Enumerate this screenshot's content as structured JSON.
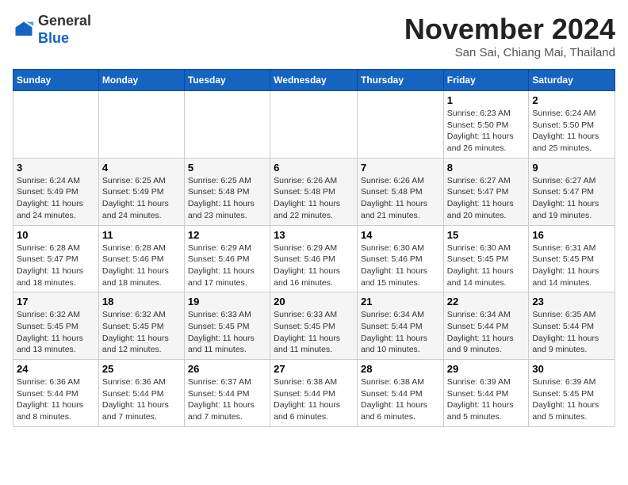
{
  "logo": {
    "general": "General",
    "blue": "Blue"
  },
  "title": "November 2024",
  "location": "San Sai, Chiang Mai, Thailand",
  "days_of_week": [
    "Sunday",
    "Monday",
    "Tuesday",
    "Wednesday",
    "Thursday",
    "Friday",
    "Saturday"
  ],
  "weeks": [
    [
      {
        "day": "",
        "info": ""
      },
      {
        "day": "",
        "info": ""
      },
      {
        "day": "",
        "info": ""
      },
      {
        "day": "",
        "info": ""
      },
      {
        "day": "",
        "info": ""
      },
      {
        "day": "1",
        "info": "Sunrise: 6:23 AM\nSunset: 5:50 PM\nDaylight: 11 hours and 26 minutes."
      },
      {
        "day": "2",
        "info": "Sunrise: 6:24 AM\nSunset: 5:50 PM\nDaylight: 11 hours and 25 minutes."
      }
    ],
    [
      {
        "day": "3",
        "info": "Sunrise: 6:24 AM\nSunset: 5:49 PM\nDaylight: 11 hours and 24 minutes."
      },
      {
        "day": "4",
        "info": "Sunrise: 6:25 AM\nSunset: 5:49 PM\nDaylight: 11 hours and 24 minutes."
      },
      {
        "day": "5",
        "info": "Sunrise: 6:25 AM\nSunset: 5:48 PM\nDaylight: 11 hours and 23 minutes."
      },
      {
        "day": "6",
        "info": "Sunrise: 6:26 AM\nSunset: 5:48 PM\nDaylight: 11 hours and 22 minutes."
      },
      {
        "day": "7",
        "info": "Sunrise: 6:26 AM\nSunset: 5:48 PM\nDaylight: 11 hours and 21 minutes."
      },
      {
        "day": "8",
        "info": "Sunrise: 6:27 AM\nSunset: 5:47 PM\nDaylight: 11 hours and 20 minutes."
      },
      {
        "day": "9",
        "info": "Sunrise: 6:27 AM\nSunset: 5:47 PM\nDaylight: 11 hours and 19 minutes."
      }
    ],
    [
      {
        "day": "10",
        "info": "Sunrise: 6:28 AM\nSunset: 5:47 PM\nDaylight: 11 hours and 18 minutes."
      },
      {
        "day": "11",
        "info": "Sunrise: 6:28 AM\nSunset: 5:46 PM\nDaylight: 11 hours and 18 minutes."
      },
      {
        "day": "12",
        "info": "Sunrise: 6:29 AM\nSunset: 5:46 PM\nDaylight: 11 hours and 17 minutes."
      },
      {
        "day": "13",
        "info": "Sunrise: 6:29 AM\nSunset: 5:46 PM\nDaylight: 11 hours and 16 minutes."
      },
      {
        "day": "14",
        "info": "Sunrise: 6:30 AM\nSunset: 5:46 PM\nDaylight: 11 hours and 15 minutes."
      },
      {
        "day": "15",
        "info": "Sunrise: 6:30 AM\nSunset: 5:45 PM\nDaylight: 11 hours and 14 minutes."
      },
      {
        "day": "16",
        "info": "Sunrise: 6:31 AM\nSunset: 5:45 PM\nDaylight: 11 hours and 14 minutes."
      }
    ],
    [
      {
        "day": "17",
        "info": "Sunrise: 6:32 AM\nSunset: 5:45 PM\nDaylight: 11 hours and 13 minutes."
      },
      {
        "day": "18",
        "info": "Sunrise: 6:32 AM\nSunset: 5:45 PM\nDaylight: 11 hours and 12 minutes."
      },
      {
        "day": "19",
        "info": "Sunrise: 6:33 AM\nSunset: 5:45 PM\nDaylight: 11 hours and 11 minutes."
      },
      {
        "day": "20",
        "info": "Sunrise: 6:33 AM\nSunset: 5:45 PM\nDaylight: 11 hours and 11 minutes."
      },
      {
        "day": "21",
        "info": "Sunrise: 6:34 AM\nSunset: 5:44 PM\nDaylight: 11 hours and 10 minutes."
      },
      {
        "day": "22",
        "info": "Sunrise: 6:34 AM\nSunset: 5:44 PM\nDaylight: 11 hours and 9 minutes."
      },
      {
        "day": "23",
        "info": "Sunrise: 6:35 AM\nSunset: 5:44 PM\nDaylight: 11 hours and 9 minutes."
      }
    ],
    [
      {
        "day": "24",
        "info": "Sunrise: 6:36 AM\nSunset: 5:44 PM\nDaylight: 11 hours and 8 minutes."
      },
      {
        "day": "25",
        "info": "Sunrise: 6:36 AM\nSunset: 5:44 PM\nDaylight: 11 hours and 7 minutes."
      },
      {
        "day": "26",
        "info": "Sunrise: 6:37 AM\nSunset: 5:44 PM\nDaylight: 11 hours and 7 minutes."
      },
      {
        "day": "27",
        "info": "Sunrise: 6:38 AM\nSunset: 5:44 PM\nDaylight: 11 hours and 6 minutes."
      },
      {
        "day": "28",
        "info": "Sunrise: 6:38 AM\nSunset: 5:44 PM\nDaylight: 11 hours and 6 minutes."
      },
      {
        "day": "29",
        "info": "Sunrise: 6:39 AM\nSunset: 5:44 PM\nDaylight: 11 hours and 5 minutes."
      },
      {
        "day": "30",
        "info": "Sunrise: 6:39 AM\nSunset: 5:45 PM\nDaylight: 11 hours and 5 minutes."
      }
    ]
  ]
}
